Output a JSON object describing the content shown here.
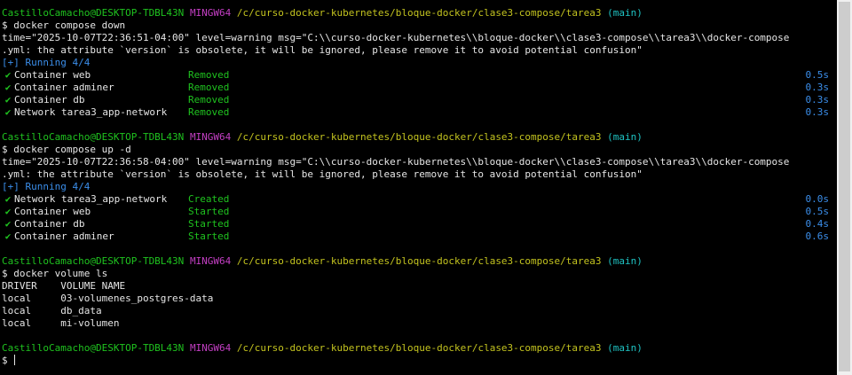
{
  "prompt": {
    "user_host": "CastilloCamacho@DESKTOP-TDBL43N",
    "shell": "MINGW64",
    "path": "/c/curso-docker-kubernetes/bloque-docker/clase3-compose/tarea3",
    "branch": "(main)",
    "symbol": "$"
  },
  "blocks": [
    {
      "command": "docker compose down",
      "warning_line1": "time=\"2025-10-07T22:36:51-04:00\" level=warning msg=\"C:\\\\curso-docker-kubernetes\\\\bloque-docker\\\\clase3-compose\\\\tarea3\\\\docker-compose",
      "warning_line2": ".yml: the attribute `version` is obsolete, it will be ignored, please remove it to avoid potential confusion\"",
      "running": "[+] Running 4/4",
      "items": [
        {
          "check": "✔",
          "name": "Container web",
          "status": "Removed",
          "duration": "0.5s"
        },
        {
          "check": "✔",
          "name": "Container adminer",
          "status": "Removed",
          "duration": "0.3s"
        },
        {
          "check": "✔",
          "name": "Container db",
          "status": "Removed",
          "duration": "0.3s"
        },
        {
          "check": "✔",
          "name": "Network tarea3_app-network",
          "status": "Removed",
          "duration": "0.3s"
        }
      ]
    },
    {
      "command": "docker compose up -d",
      "warning_line1": "time=\"2025-10-07T22:36:58-04:00\" level=warning msg=\"C:\\\\curso-docker-kubernetes\\\\bloque-docker\\\\clase3-compose\\\\tarea3\\\\docker-compose",
      "warning_line2": ".yml: the attribute `version` is obsolete, it will be ignored, please remove it to avoid potential confusion\"",
      "running": "[+] Running 4/4",
      "items": [
        {
          "check": "✔",
          "name": "Network tarea3_app-network",
          "status": "Created",
          "duration": "0.0s"
        },
        {
          "check": "✔",
          "name": "Container web",
          "status": "Started",
          "duration": "0.5s"
        },
        {
          "check": "✔",
          "name": "Container db",
          "status": "Started",
          "duration": "0.4s"
        },
        {
          "check": "✔",
          "name": "Container adminer",
          "status": "Started",
          "duration": "0.6s"
        }
      ]
    }
  ],
  "volume_block": {
    "command": "docker volume ls",
    "header": "DRIVER    VOLUME NAME",
    "rows": [
      "local     03-volumenes_postgres-data",
      "local     db_data",
      "local     mi-volumen"
    ]
  }
}
